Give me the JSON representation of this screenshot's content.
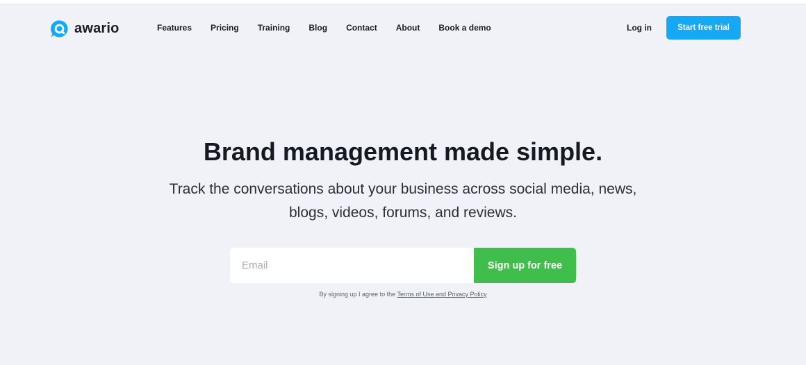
{
  "header": {
    "logo_text": "awario",
    "nav": [
      "Features",
      "Pricing",
      "Training",
      "Blog",
      "Contact",
      "About",
      "Book a demo"
    ],
    "login_label": "Log in",
    "trial_label": "Start free trial"
  },
  "hero": {
    "title": "Brand management made simple.",
    "subtitle": "Track the conversations about your business across social media, news, blogs, videos, forums, and reviews."
  },
  "signup": {
    "email_placeholder": "Email",
    "button_label": "Sign up for free",
    "legal_prefix": "By signing up I agree to the",
    "legal_link": "Terms of Use and Privacy Policy"
  },
  "colors": {
    "background": "#f1f2f8",
    "trial_button": "#14a8f5",
    "signup_button": "#3fbe4c",
    "logo": "#14a8f5"
  },
  "icons": {
    "logo": "awario-speech-bubble-icon"
  }
}
